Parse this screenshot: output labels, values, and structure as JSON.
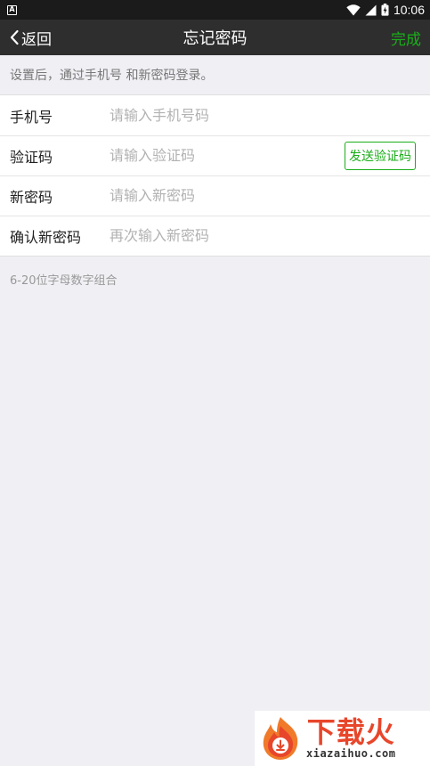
{
  "status_bar": {
    "notification_icon": "android-notification-icon",
    "notification_glyph": "A",
    "wifi_icon": "wifi-icon",
    "signal_icon": "cell-signal-icon",
    "battery_icon": "battery-charging-icon",
    "time": "10:06"
  },
  "nav": {
    "back_label": "返回",
    "title": "忘记密码",
    "done_label": "完成",
    "accent_color": "#1aad19"
  },
  "tip": "设置后，通过手机号 和新密码登录。",
  "form": {
    "phone": {
      "label": "手机号",
      "placeholder": "请输入手机号码"
    },
    "code": {
      "label": "验证码",
      "placeholder": "请输入验证码",
      "button": "发送验证码"
    },
    "new_password": {
      "label": "新密码",
      "placeholder": "请输入新密码"
    },
    "confirm_password": {
      "label": "确认新密码",
      "placeholder": "再次输入新密码"
    }
  },
  "hint": "6-20位字母数字组合",
  "watermark": {
    "cn": "下载火",
    "en": "xiazaihuo.com",
    "color": "#e8462b"
  }
}
